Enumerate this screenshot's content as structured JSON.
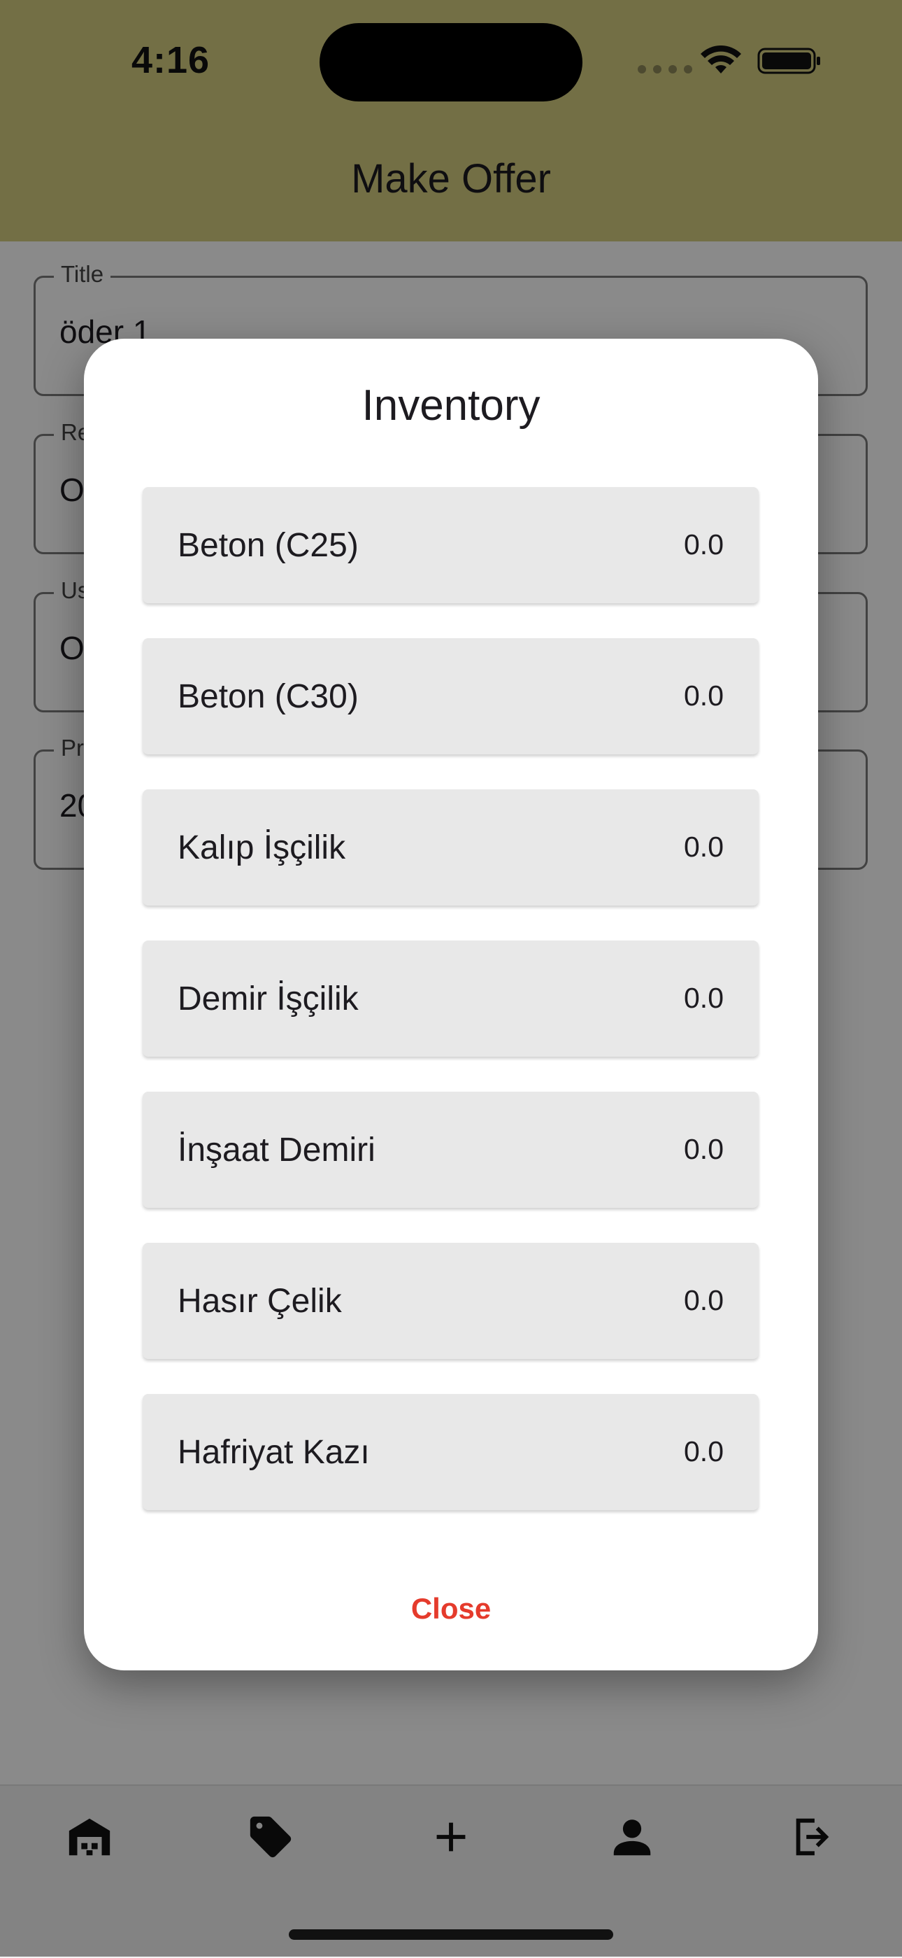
{
  "status_bar": {
    "time": "4:16"
  },
  "app_bar": {
    "title": "Make Offer"
  },
  "form": {
    "fields": [
      {
        "label": "Title",
        "value": "öder 1"
      },
      {
        "label": "Re",
        "value": "O"
      },
      {
        "label": "Us",
        "value": "O"
      },
      {
        "label": "Pr",
        "value": "20"
      }
    ]
  },
  "dialog": {
    "title": "Inventory",
    "items": [
      {
        "name": "Beton (C25)",
        "value": "0.0"
      },
      {
        "name": "Beton (C30)",
        "value": "0.0"
      },
      {
        "name": "Kalıp İşçilik",
        "value": "0.0"
      },
      {
        "name": "Demir İşçilik",
        "value": "0.0"
      },
      {
        "name": "İnşaat Demiri",
        "value": "0.0"
      },
      {
        "name": "Hasır Çelik",
        "value": "0.0"
      },
      {
        "name": "Hafriyat Kazı",
        "value": "0.0"
      }
    ],
    "close_label": "Close"
  },
  "bottom_nav": {
    "icons": [
      "warehouse-icon",
      "tag-icon",
      "add-icon",
      "person-icon",
      "logout-icon"
    ]
  },
  "colors": {
    "app_bar": "#d4cd80",
    "close_accent": "#e53b2c",
    "item_background": "#e8e8e8"
  }
}
